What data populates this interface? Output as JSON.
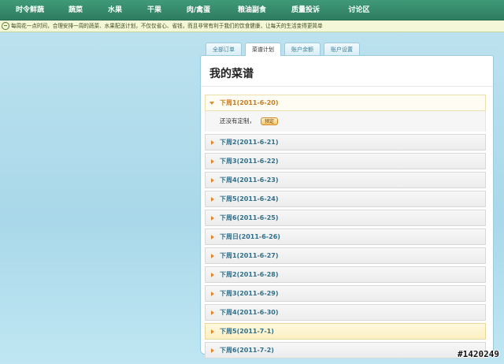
{
  "nav": {
    "items": [
      "时令鲜蔬",
      "蔬菜",
      "水果",
      "干果",
      "肉/禽蛋",
      "粮油副食",
      "质量投诉",
      "讨论区"
    ]
  },
  "notice": {
    "text": "每周花一点时间，合理安排一周的蔬菜、水果配送计划，不仅仅省心、省钱，而且非常有利于我们的饮食健康，让每天的生活变得更简单"
  },
  "tabs": [
    {
      "label": "全部订单",
      "active": false
    },
    {
      "label": "菜谱计划",
      "active": true
    },
    {
      "label": "账户余额",
      "active": false
    },
    {
      "label": "账户设置",
      "active": false
    }
  ],
  "panel": {
    "title": "我的菜谱",
    "open_item": {
      "label": "下周1(2011-6-20)",
      "body_text": "还没有定制，",
      "button_label": "预定"
    },
    "items": [
      {
        "label": "下周2(2011-6-21)"
      },
      {
        "label": "下周3(2011-6-22)"
      },
      {
        "label": "下周4(2011-6-23)"
      },
      {
        "label": "下周5(2011-6-24)"
      },
      {
        "label": "下周6(2011-6-25)"
      },
      {
        "label": "下周日(2011-6-26)"
      },
      {
        "label": "下周1(2011-6-27)"
      },
      {
        "label": "下周2(2011-6-28)"
      },
      {
        "label": "下周3(2011-6-29)"
      },
      {
        "label": "下周4(2011-6-30)"
      },
      {
        "label": "下周5(2011-7-1)"
      },
      {
        "label": "下周6(2011-7-2)"
      }
    ]
  },
  "watermark": "#1420249",
  "colors": {
    "nav_bg": "#2e7d60",
    "notice_bg": "#f4f7d8",
    "accent_orange": "#e08a2a",
    "label_blue": "#2f6f8a",
    "page_bg": "#a9d8ea"
  }
}
